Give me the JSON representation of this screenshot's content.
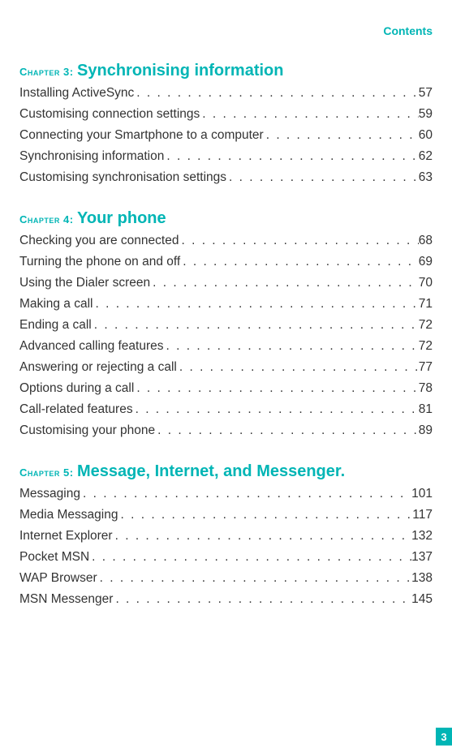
{
  "header_link": "Contents",
  "page_number": "3",
  "chapters": [
    {
      "prefix": "Chapter  3:",
      "title": "Synchronising information",
      "entries": [
        {
          "label": "Installing ActiveSync ",
          "page": "57"
        },
        {
          "label": "Customising connection settings ",
          "page": "59"
        },
        {
          "label": "Connecting your Smartphone to a computer",
          "page": "60"
        },
        {
          "label": "Synchronising information  ",
          "page": "62"
        },
        {
          "label": "Customising synchronisation settings  ",
          "page": "63"
        }
      ]
    },
    {
      "prefix": "Chapter  4:",
      "title": "Your phone",
      "entries": [
        {
          "label": "Checking you are connected ",
          "page": "68"
        },
        {
          "label": "Turning the phone on and off ",
          "page": "69"
        },
        {
          "label": "Using the Dialer screen  ",
          "page": "70"
        },
        {
          "label": "Making a call  ",
          "page": "71"
        },
        {
          "label": "Ending a call",
          "page": "72"
        },
        {
          "label": "Advanced calling features",
          "page": "72"
        },
        {
          "label": "Answering or rejecting a call",
          "page": "77"
        },
        {
          "label": "Options during a call ",
          "page": "78"
        },
        {
          "label": "Call-related features  ",
          "page": "81"
        },
        {
          "label": "Customising your phone",
          "page": "89"
        }
      ]
    },
    {
      "prefix": "Chapter  5:",
      "title": "Message, Internet, and Messenger.",
      "entries": [
        {
          "label": "Messaging  ",
          "page": "101"
        },
        {
          "label": "Media Messaging ",
          "page": "117"
        },
        {
          "label": "Internet Explorer",
          "page": "132"
        },
        {
          "label": "Pocket MSN  ",
          "page": "137"
        },
        {
          "label": "WAP Browser  ",
          "page": "138"
        },
        {
          "label": "MSN Messenger  ",
          "page": "145"
        }
      ]
    }
  ]
}
